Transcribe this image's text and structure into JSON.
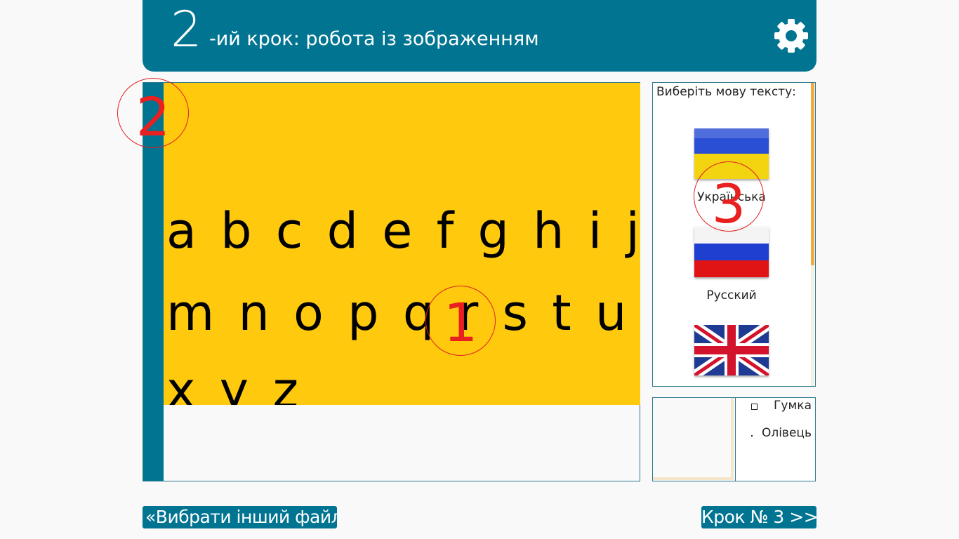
{
  "header": {
    "step_number": "2",
    "step_title": "-ий крок: робота із зображенням",
    "settings_icon": "gear-icon"
  },
  "image": {
    "top_mark": "ˇ",
    "letter_lines": [
      "a b c d e f g h i j k",
      "m n o p q r s t u v",
      "x y z"
    ],
    "callouts": {
      "one": "1",
      "two": "2",
      "three": "3"
    }
  },
  "language_panel": {
    "prompt": "Виберіть мову тексту:",
    "languages": [
      {
        "label": "Українська",
        "flag": "ukraine-flag-icon"
      },
      {
        "label": "Русский",
        "flag": "russia-flag-icon"
      },
      {
        "label": "",
        "flag": "uk-flag-icon"
      }
    ]
  },
  "tools": {
    "eraser_label": "Гумка",
    "pencil_label": "Олівець"
  },
  "footer": {
    "back_button": "«Вибрати інший файл",
    "next_button": "Крок № 3 >>"
  },
  "colors": {
    "accent": "#007491",
    "image_background": "#ffc90e",
    "callout_red": "#e82020",
    "scroll_thumb": "#f4a941"
  }
}
